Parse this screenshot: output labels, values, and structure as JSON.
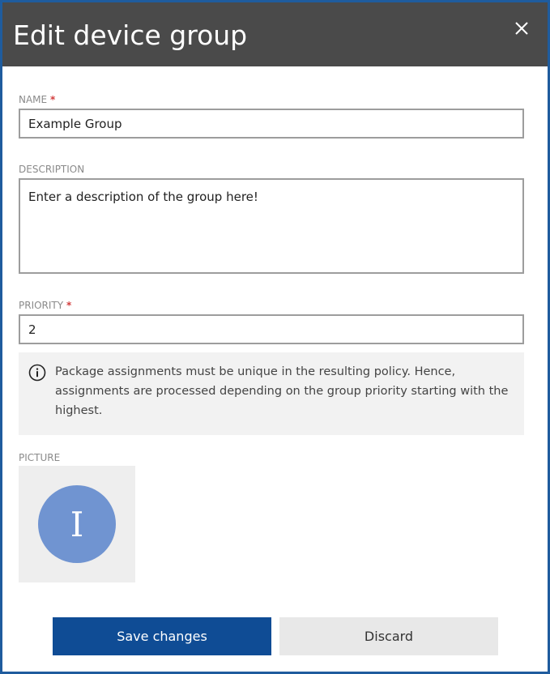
{
  "dialog": {
    "title": "Edit device group",
    "close_icon": "close-icon"
  },
  "name_field": {
    "label": "NAME",
    "required_marker": "*",
    "value": "Example Group"
  },
  "description_field": {
    "label": "DESCRIPTION",
    "value": "Enter a description of the group here!"
  },
  "priority_field": {
    "label": "PRIORITY",
    "required_marker": "*",
    "value": "2"
  },
  "info": {
    "icon": "info-icon",
    "text": "Package assignments must be unique in the resulting policy. Hence, assignments are processed depending on the group priority starting with the highest."
  },
  "picture": {
    "label": "PICTURE",
    "avatar_letter": "I",
    "avatar_color": "#7094d1"
  },
  "actions": {
    "save_label": "Save changes",
    "discard_label": "Discard"
  },
  "colors": {
    "header_bg": "#4a4a4a",
    "primary": "#0f4c95",
    "border": "#1f5c9e",
    "required": "#d23d3d"
  }
}
